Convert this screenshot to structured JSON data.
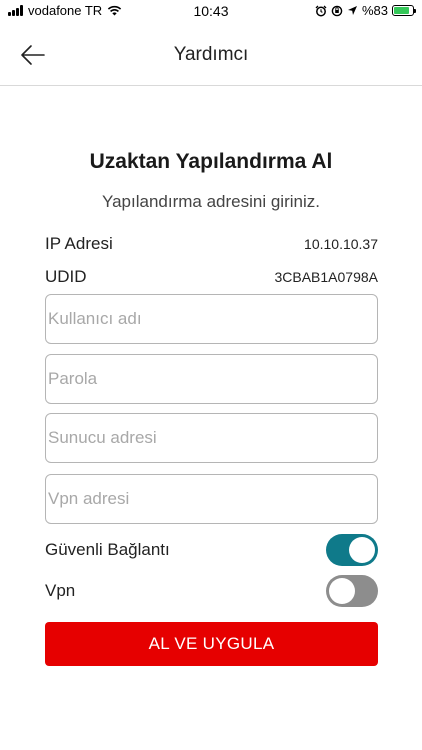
{
  "status_bar": {
    "carrier": "vodafone TR",
    "time": "10:43",
    "battery": "%83",
    "battery_level": 0.83
  },
  "nav": {
    "title": "Yardımcı",
    "back_icon": "arrow-left-icon"
  },
  "main": {
    "title": "Uzaktan Yapılandırma Al",
    "subtitle": "Yapılandırma adresini giriniz.",
    "info": [
      {
        "label": "IP Adresi",
        "value": "10.10.10.37"
      },
      {
        "label": "UDID",
        "value": "3CBAB1A0798A"
      }
    ],
    "fields": {
      "username": {
        "placeholder": "Kullanıcı adı",
        "value": ""
      },
      "password": {
        "placeholder": "Parola",
        "value": ""
      },
      "server": {
        "placeholder": "Sunucu adresi",
        "value": ""
      },
      "vpn_address": {
        "placeholder": "Vpn adresi",
        "value": ""
      }
    },
    "toggles": {
      "secure_connection": {
        "label": "Güvenli Bağlantı",
        "on": true
      },
      "vpn": {
        "label": "Vpn",
        "on": false
      }
    },
    "submit_label": "AL VE UYGULA"
  },
  "colors": {
    "accent_red": "#e60000",
    "toggle_on": "#0f7a8a",
    "toggle_off": "#8d8d8d"
  }
}
